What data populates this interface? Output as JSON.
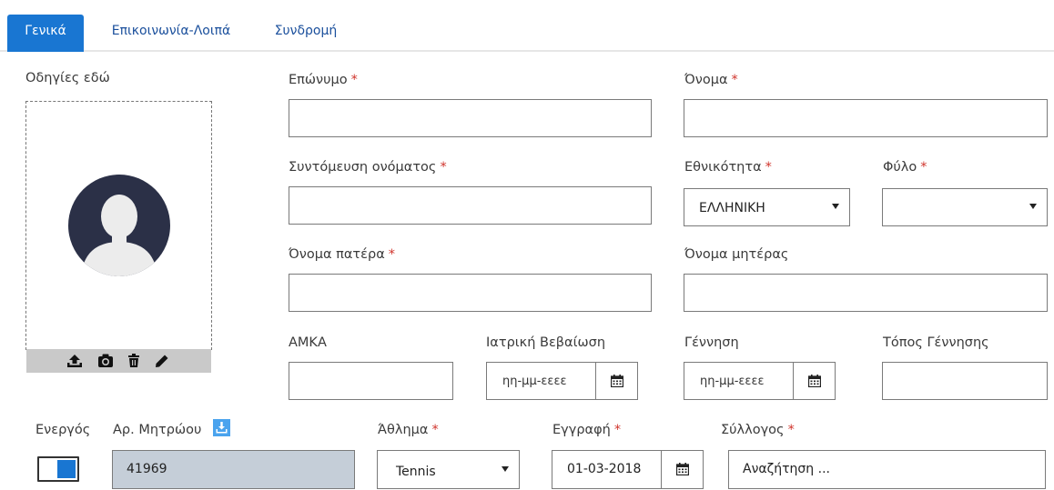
{
  "tabs": [
    {
      "label": "Γενικά",
      "active": true
    },
    {
      "label": "Επικοινωνία-Λοιπά",
      "active": false
    },
    {
      "label": "Συνδρομή",
      "active": false
    }
  ],
  "photo": {
    "instructions_label": "Οδηγίες εδώ",
    "tool_icons": [
      "upload-icon",
      "camera-icon",
      "trash-icon",
      "pencil-icon"
    ]
  },
  "fields": {
    "surname": {
      "label": "Επώνυμο",
      "required": "*",
      "value": ""
    },
    "first_name": {
      "label": "Όνομα",
      "required": "*",
      "value": ""
    },
    "name_abbrev": {
      "label": "Συντόμευση ονόματος",
      "required": "*",
      "value": ""
    },
    "nationality": {
      "label": "Εθνικότητα",
      "required": "*",
      "value": "ΕΛΛΗΝΙΚΗ"
    },
    "gender": {
      "label": "Φύλο",
      "required": "*",
      "value": ""
    },
    "father_name": {
      "label": "Όνομα πατέρα",
      "required": "*",
      "value": ""
    },
    "mother_name": {
      "label": "Όνομα μητέρας",
      "value": ""
    },
    "amka": {
      "label": "ΑΜΚΑ",
      "value": ""
    },
    "medical_cert": {
      "label": "Ιατρική Βεβαίωση",
      "value": "ηη-μμ-εεεε"
    },
    "birth": {
      "label": "Γέννηση",
      "value": "ηη-μμ-εεεε"
    },
    "birthplace": {
      "label": "Τόπος Γέννησης",
      "value": ""
    },
    "active": {
      "label": "Ενεργός",
      "on": true
    },
    "registry_no": {
      "label": "Αρ. Μητρώου",
      "value": "41969"
    },
    "sport": {
      "label": "Άθλημα",
      "required": "*",
      "value": "Tennis"
    },
    "registration": {
      "label": "Εγγραφή",
      "required": "*",
      "value": "01-03-2018"
    },
    "club": {
      "label": "Σύλλογος",
      "required": "*",
      "value": "Αναζήτηση ..."
    }
  },
  "colors": {
    "accent": "#1976d2",
    "required": "#d0342c",
    "readonly_bg": "#c5ced8"
  }
}
